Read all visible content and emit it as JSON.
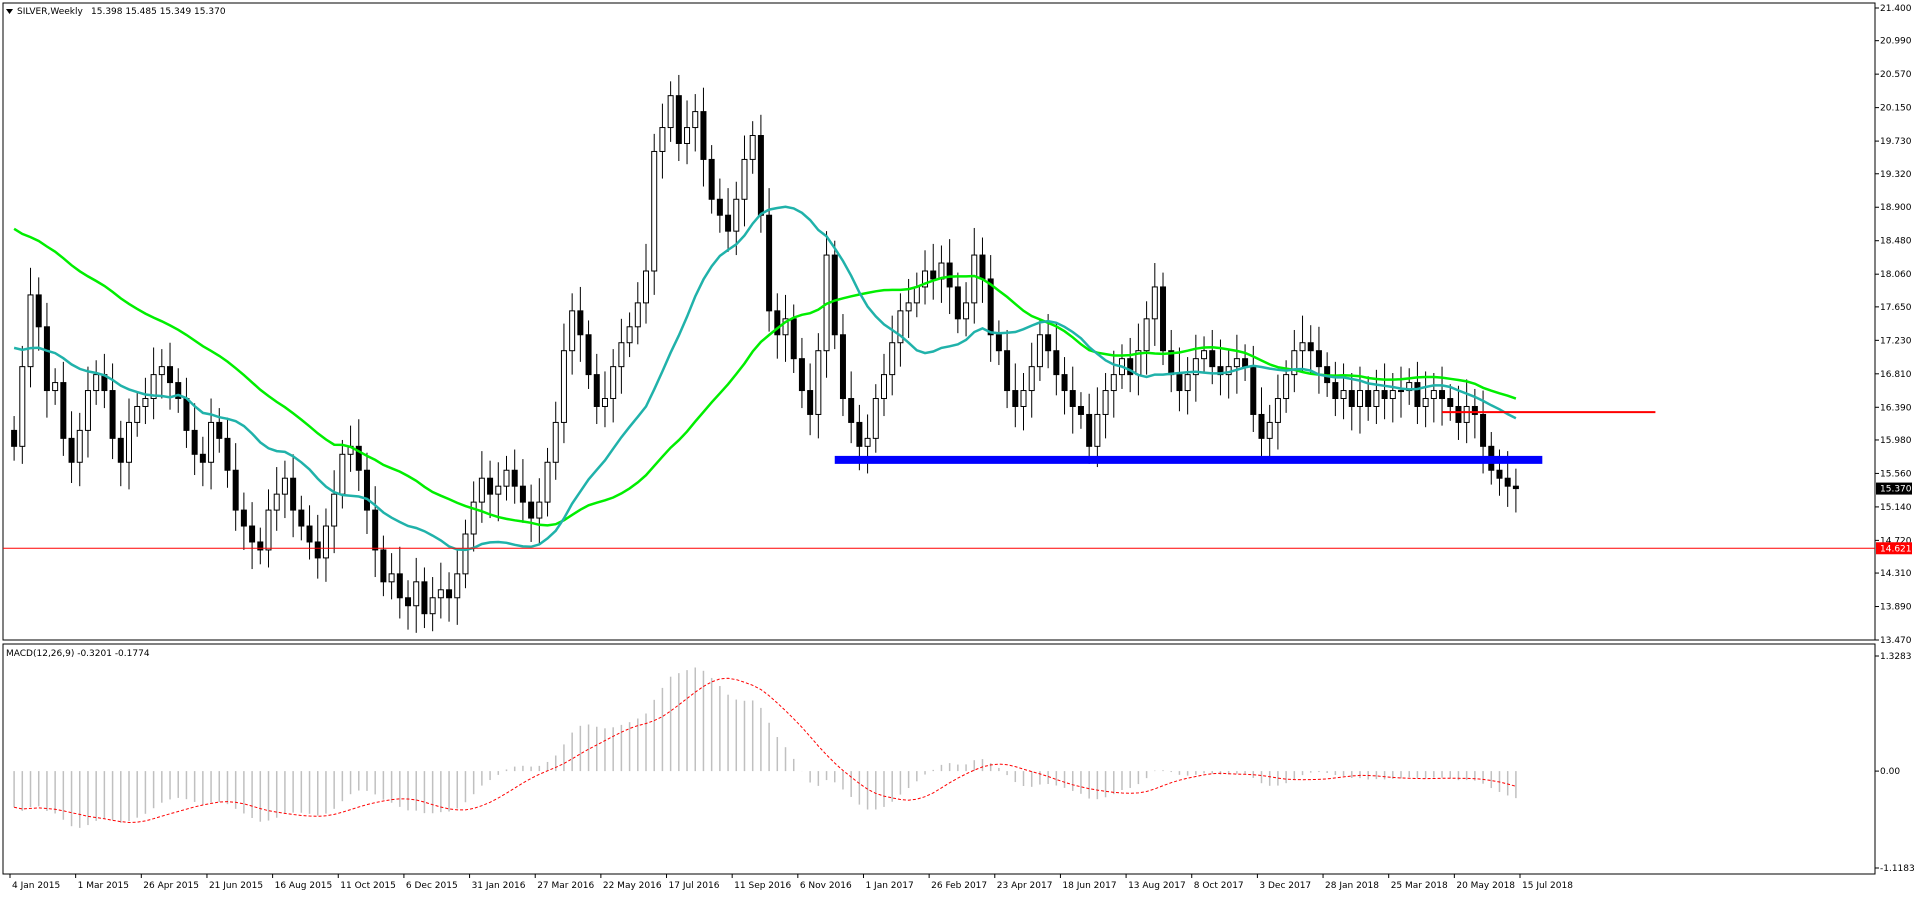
{
  "chart_window": {
    "symbol_label": "SILVER,Weekly",
    "ohlc_label": "15.398 15.485 15.349 15.370",
    "menu_icon": "triangle-down-icon"
  },
  "price_axis": {
    "ticks": [
      "21.400",
      "20.990",
      "20.570",
      "20.150",
      "19.730",
      "19.320",
      "18.900",
      "18.480",
      "18.060",
      "17.650",
      "17.230",
      "16.810",
      "16.390",
      "15.980",
      "15.560",
      "15.140",
      "14.720",
      "14.310",
      "13.890",
      "13.470"
    ],
    "current_price_label": "15.370",
    "line_price_label": "14.621",
    "colors": {
      "current_bg": "#000000",
      "line_bg": "#ff0000"
    }
  },
  "macd_axis": {
    "label": "MACD(12,26,9) -0.3201 -0.1774",
    "ticks": [
      "1.3283",
      "0.00",
      "-1.1183"
    ]
  },
  "time_axis": {
    "labels": [
      "4 Jan 2015",
      "1 Mar 2015",
      "26 Apr 2015",
      "21 Jun 2015",
      "16 Aug 2015",
      "11 Oct 2015",
      "6 Dec 2015",
      "31 Jan 2016",
      "27 Mar 2016",
      "22 May 2016",
      "17 Jul 2016",
      "11 Sep 2016",
      "6 Nov 2016",
      "1 Jan 2017",
      "26 Feb 2017",
      "23 Apr 2017",
      "18 Jun 2017",
      "13 Aug 2017",
      "8 Oct 2017",
      "3 Dec 2017",
      "28 Jan 2018",
      "25 Mar 2018",
      "20 May 2018",
      "15 Jul 2018"
    ]
  },
  "chart_data": {
    "type": "candlestick",
    "title": "SILVER,Weekly",
    "ylim": [
      13.47,
      21.4
    ],
    "x_start": "4 Jan 2015",
    "x_step": "1 week",
    "closes": [
      15.9,
      16.9,
      17.8,
      17.4,
      16.6,
      16.7,
      16.0,
      15.7,
      16.1,
      16.6,
      16.8,
      16.6,
      16.0,
      15.7,
      16.2,
      16.4,
      16.5,
      16.8,
      16.9,
      16.7,
      16.5,
      16.1,
      15.8,
      15.7,
      16.2,
      16.0,
      15.6,
      15.1,
      14.9,
      14.7,
      14.6,
      15.1,
      15.3,
      15.5,
      15.1,
      14.9,
      14.7,
      14.5,
      14.9,
      15.3,
      15.8,
      15.9,
      15.6,
      15.1,
      14.6,
      14.2,
      14.3,
      14.0,
      13.9,
      14.2,
      13.8,
      14.0,
      14.1,
      14.0,
      14.3,
      14.8,
      15.2,
      15.5,
      15.3,
      15.4,
      15.6,
      15.4,
      15.2,
      15.0,
      15.2,
      15.7,
      16.2,
      17.1,
      17.6,
      17.3,
      16.8,
      16.4,
      16.5,
      16.9,
      17.2,
      17.4,
      17.7,
      18.1,
      19.6,
      19.9,
      20.3,
      19.7,
      19.9,
      20.1,
      19.5,
      19.0,
      18.8,
      18.6,
      19.0,
      19.5,
      19.8,
      18.8,
      17.6,
      17.3,
      17.5,
      17.0,
      16.6,
      16.3,
      17.1,
      18.3,
      17.3,
      16.5,
      16.2,
      15.9,
      16.0,
      16.5,
      16.8,
      17.2,
      17.6,
      17.7,
      17.9,
      18.1,
      18.0,
      18.2,
      17.9,
      17.5,
      17.7,
      18.3,
      18.0,
      17.3,
      17.1,
      16.6,
      16.4,
      16.6,
      16.9,
      17.3,
      17.1,
      16.8,
      16.6,
      16.4,
      16.3,
      15.9,
      16.3,
      16.6,
      16.8,
      17.0,
      16.8,
      17.1,
      17.5,
      17.9,
      17.1,
      16.8,
      16.6,
      16.8,
      17.0,
      17.1,
      16.9,
      16.8,
      16.9,
      17.0,
      16.9,
      16.3,
      16.0,
      16.2,
      16.5,
      16.8,
      17.1,
      17.2,
      17.1,
      16.9,
      16.7,
      16.5,
      16.6,
      16.4,
      16.6,
      16.4,
      16.6,
      16.5,
      16.6,
      16.6,
      16.7,
      16.4,
      16.5,
      16.6,
      16.5,
      16.4,
      16.2,
      16.4,
      16.3,
      15.9,
      15.6,
      15.5,
      15.4,
      15.37
    ],
    "ohlc_current": {
      "open": 15.398,
      "high": 15.485,
      "low": 15.349,
      "close": 15.37
    },
    "horizontal_line": 14.621,
    "support_zone": [
      15.68,
      15.78
    ],
    "resistance_segment": 16.33,
    "series": [
      {
        "name": "MA slow",
        "color": "#00ee00"
      },
      {
        "name": "MA fast",
        "color": "#20b2aa"
      }
    ],
    "macd": {
      "fast": 12,
      "slow": 26,
      "signal": 9,
      "main": -0.3201,
      "signal_value": -0.1774,
      "ylim": [
        -1.1183,
        1.3283
      ]
    },
    "grid": false
  }
}
